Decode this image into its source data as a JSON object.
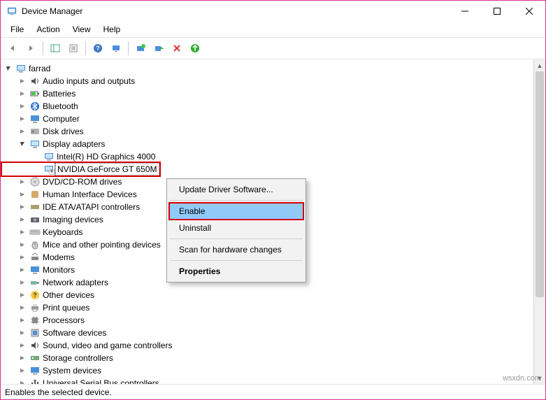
{
  "window": {
    "title": "Device Manager"
  },
  "menu": {
    "file": "File",
    "action": "Action",
    "view": "View",
    "help": "Help"
  },
  "tree": {
    "root": "farrad",
    "items": [
      "Audio inputs and outputs",
      "Batteries",
      "Bluetooth",
      "Computer",
      "Disk drives"
    ],
    "display_adapters": {
      "label": "Display adapters",
      "children": {
        "intel": "Intel(R) HD Graphics 4000",
        "nvidia": "NVIDIA GeForce GT 650M"
      }
    },
    "rest": [
      "DVD/CD-ROM drives",
      "Human Interface Devices",
      "IDE ATA/ATAPI controllers",
      "Imaging devices",
      "Keyboards",
      "Mice and other pointing devices",
      "Modems",
      "Monitors",
      "Network adapters",
      "Other devices",
      "Print queues",
      "Processors",
      "Software devices",
      "Sound, video and game controllers",
      "Storage controllers",
      "System devices",
      "Universal Serial Bus controllers"
    ]
  },
  "context_menu": {
    "update": "Update Driver Software...",
    "enable": "Enable",
    "uninstall": "Uninstall",
    "scan": "Scan for hardware changes",
    "properties": "Properties"
  },
  "statusbar": "Enables the selected device.",
  "watermark": "wsxdn.com",
  "icons": {
    "audio": "audio-icon",
    "battery": "battery-icon",
    "bluetooth": "bluetooth-icon",
    "computer": "computer-icon",
    "disk": "disk-icon",
    "display": "display-icon",
    "dvd": "dvd-icon",
    "hid": "hid-icon",
    "ide": "ide-icon",
    "imaging": "imaging-icon",
    "keyboard": "keyboard-icon",
    "mouse": "mouse-icon",
    "modem": "modem-icon",
    "monitor": "monitor-icon",
    "network": "network-icon",
    "other": "other-icon",
    "print": "print-icon",
    "processor": "processor-icon",
    "software": "software-icon",
    "sound": "sound-icon",
    "storage": "storage-icon",
    "system": "system-icon",
    "usb": "usb-icon"
  }
}
